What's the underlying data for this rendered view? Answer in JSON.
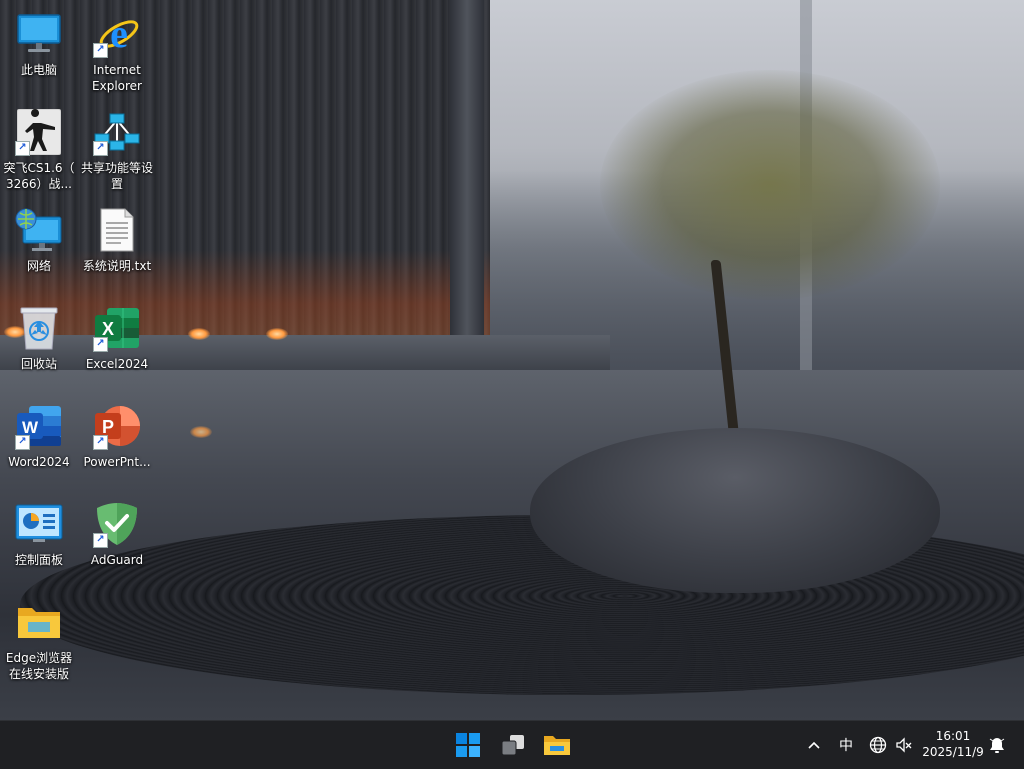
{
  "desktop": {
    "icons": [
      {
        "name": "此电脑",
        "icon": "computer-icon"
      },
      {
        "name": "Internet\nExplorer",
        "icon": "internet-explorer-icon"
      },
      {
        "name": "突飞CS1.6（3266）战...",
        "icon": "counter-strike-icon"
      },
      {
        "name": "共享功能等设置",
        "icon": "network-share-icon"
      },
      {
        "name": "网络",
        "icon": "network-icon"
      },
      {
        "name": "系统说明.txt",
        "icon": "text-file-icon"
      },
      {
        "name": "回收站",
        "icon": "recycle-bin-icon"
      },
      {
        "name": "Excel2024",
        "icon": "excel-icon"
      },
      {
        "name": "Word2024",
        "icon": "word-icon"
      },
      {
        "name": "PowerPnt...",
        "icon": "powerpoint-icon"
      },
      {
        "name": "控制面板",
        "icon": "control-panel-icon"
      },
      {
        "name": "AdGuard",
        "icon": "adguard-icon"
      },
      {
        "name": "Edge浏览器在线安装版",
        "icon": "folder-icon"
      }
    ],
    "labels": {
      "this_pc": "此电脑",
      "ie_line1": "Internet",
      "ie_line2": "Explorer",
      "cs_line1": "突飞CS1.6（",
      "cs_line2": "3266）战...",
      "share_line1": "共享功能等设",
      "share_line2": "置",
      "network": "网络",
      "readme": "系统说明.txt",
      "recycle": "回收站",
      "excel": "Excel2024",
      "word": "Word2024",
      "powerpoint": "PowerPnt...",
      "control_panel": "控制面板",
      "adguard": "AdGuard",
      "edge_line1": "Edge浏览器",
      "edge_line2": "在线安装版"
    }
  },
  "taskbar": {
    "pinned": [
      "start-icon",
      "task-view-icon",
      "file-explorer-icon"
    ],
    "tray": {
      "chevron": "^",
      "ime": "中",
      "globe_icon": "globe-icon",
      "volume_icon": "volume-muted-icon",
      "notification_icon": "notification-bell-icon"
    },
    "clock": {
      "time": "16:01",
      "date": "2025/11/9"
    }
  },
  "colors": {
    "taskbar_bg": "#1f2023",
    "windows_blue": "#0078d4",
    "excel_green": "#1d6f42",
    "word_blue": "#2b579a",
    "ppt_orange": "#d24726",
    "adguard_green": "#68bc71",
    "folder_yellow": "#f8c83c"
  }
}
